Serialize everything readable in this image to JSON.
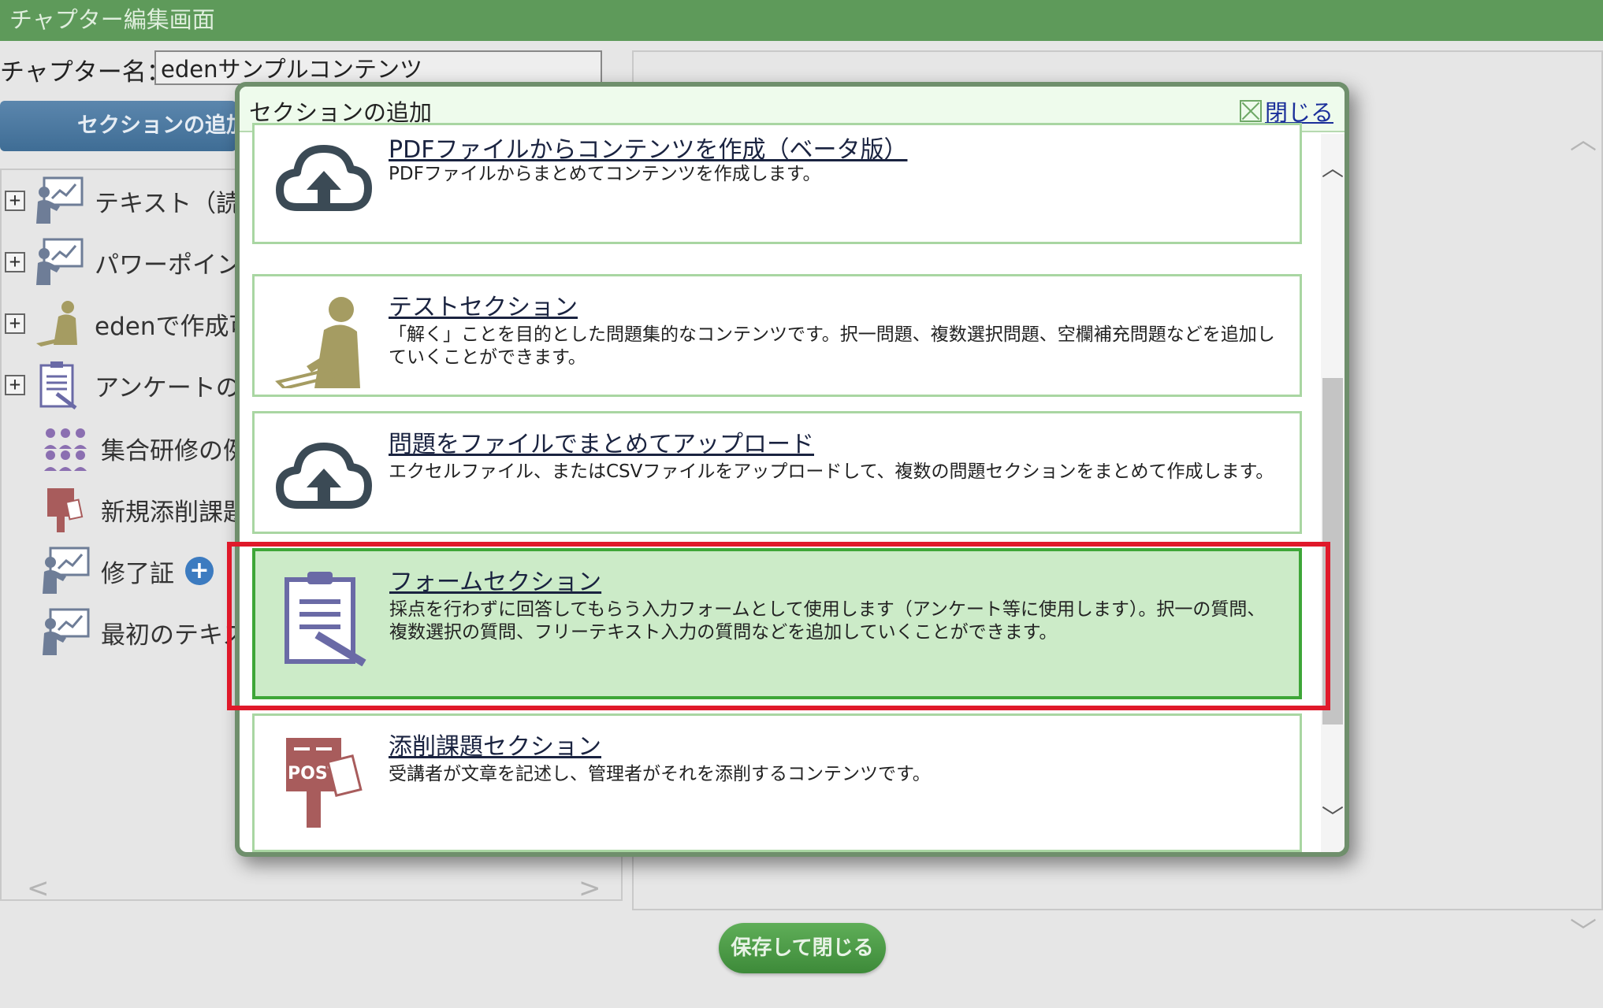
{
  "window": {
    "title": "チャプター編集画面"
  },
  "chapter": {
    "name_label": "チャプター名：",
    "name_value": "edenサンプルコンテンツ"
  },
  "toolbar": {
    "add_section_label": "セクションの追加"
  },
  "tree": {
    "items": [
      {
        "label": "テキスト（読み",
        "icon": "teacher-board-icon",
        "expandable": true
      },
      {
        "label": "パワーポイント",
        "icon": "teacher-board-icon",
        "expandable": true
      },
      {
        "label": "edenで作成可能",
        "icon": "student-desk-icon",
        "expandable": true
      },
      {
        "label": "アンケートの例",
        "icon": "clipboard-icon",
        "expandable": true
      },
      {
        "label": "集合研修の例",
        "icon": "group-icon",
        "expandable": false
      },
      {
        "label": "新規添削課題",
        "icon": "post-icon",
        "expandable": false
      },
      {
        "label": "修了証",
        "icon": "teacher-board-icon",
        "expandable": false
      },
      {
        "label": "最初のテキス",
        "icon": "teacher-board-icon",
        "expandable": false
      }
    ]
  },
  "footer": {
    "save_close_label": "保存して閉じる"
  },
  "modal": {
    "title": "セクションの追加",
    "close_label": "閉じる",
    "options": [
      {
        "title": "PDFファイルからコンテンツを作成（ベータ版）",
        "description": "PDFファイルからまとめてコンテンツを作成します。",
        "icon": "cloud-upload-icon",
        "selected": false
      },
      {
        "title": "テストセクション",
        "description": "「解く」ことを目的とした問題集的なコンテンツです。択一問題、複数選択問題、空欄補充問題などを追加していくことができます。",
        "icon": "student-writing-icon",
        "selected": false
      },
      {
        "title": "問題をファイルでまとめてアップロード",
        "description": "エクセルファイル、またはCSVファイルをアップロードして、複数の問題セクションをまとめて作成します。",
        "icon": "cloud-upload-icon",
        "selected": false
      },
      {
        "title": "フォームセクション",
        "description": "採点を行わずに回答してもらう入力フォームとして使用します（アンケート等に使用します）。択一の質問、複数選択の質問、フリーテキスト入力の質問などを追加していくことができます。",
        "icon": "clipboard-pen-icon",
        "selected": true
      },
      {
        "title": "添削課題セクション",
        "description": "受講者が文章を記述し、管理者がそれを添削するコンテンツです。",
        "icon": "post-box-icon",
        "selected": false
      }
    ]
  },
  "colors": {
    "header_green": "#5e9a5a",
    "selected_fill": "#ccebc8",
    "selected_border": "#3ea638",
    "highlight_red": "#e0192a"
  }
}
